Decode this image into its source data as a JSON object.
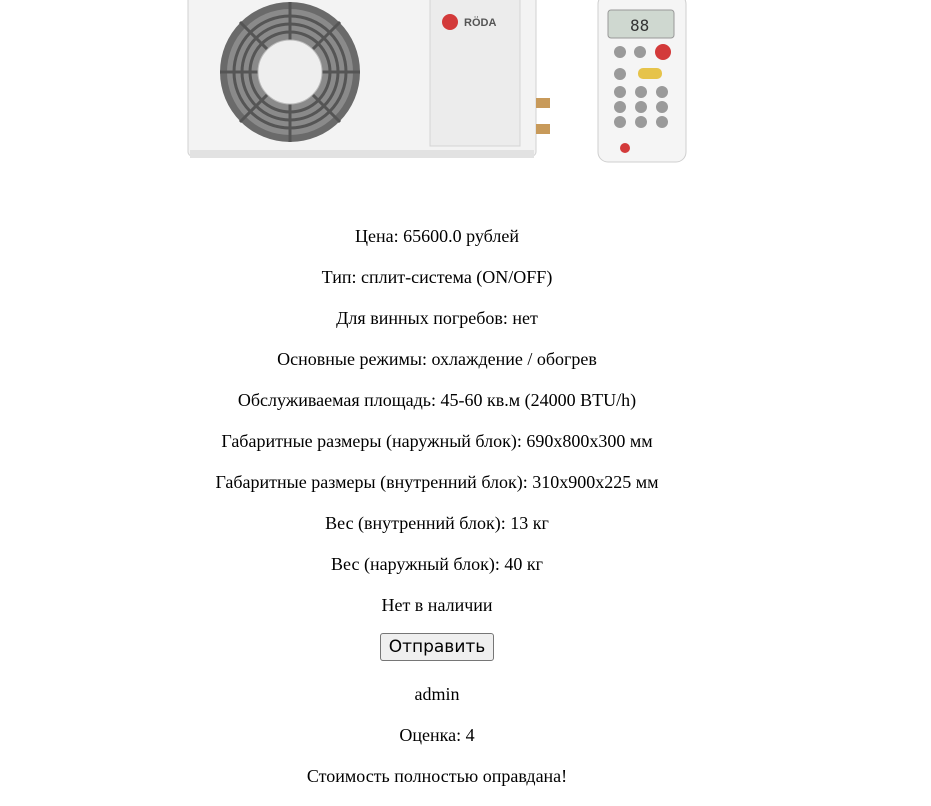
{
  "product": {
    "image_alt": "air-conditioner-with-remote",
    "brand_logo_text": "RÖDA",
    "remote_display_text": "88",
    "price_line": "Цена: 65600.0 рублей",
    "type_line": "Тип: сплит-система (ON/OFF)",
    "wine_cellar_line": "Для винных погребов: нет",
    "modes_line": "Основные режимы: охлаждение / обогрев",
    "area_line": "Обслуживаемая площадь: 45-60 кв.м (24000 BTU/h)",
    "outdoor_dimensions_line": "Габаритные размеры (наружный блок): 690х800х300 мм",
    "indoor_dimensions_line": "Габаритные размеры (внутренний блок): 310х900х225 мм",
    "indoor_weight_line": "Вес (внутренний блок): 13 кг",
    "outdoor_weight_line": "Вес (наружный блок): 40 кг",
    "availability_line": "Нет в наличии"
  },
  "form": {
    "submit_label": "Отправить"
  },
  "review": {
    "author": "admin",
    "rating_line": "Оценка: 4",
    "text": "Стоимость полностью оправдана!"
  }
}
